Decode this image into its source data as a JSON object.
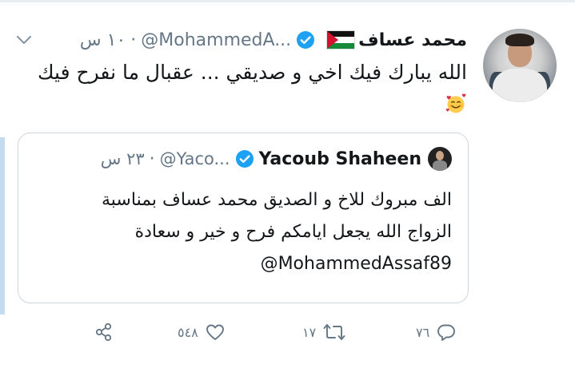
{
  "tweet": {
    "author_name": "محمد عساف",
    "handle": "@MohammedA...",
    "separator": "·",
    "time": "١٠ س",
    "text": "الله يبارك فيك اخي و صديقي ... عقبال ما نفرح فيك",
    "emoji": "smiling-face-with-hearts"
  },
  "quoted": {
    "author_name": "Yacoub Shaheen",
    "handle": "@Yaco...",
    "separator": "·",
    "time": "٢٣ س",
    "text_line1": "الف مبروك للاخ و الصديق محمد عساف بمناسبة",
    "text_line2": "الزواج الله يجعل ايامكم فرح و خير و سعادة",
    "mention": "@MohammedAssaf89"
  },
  "actions": {
    "reply_count": "٧٦",
    "retweet_count": "١٧",
    "like_count": "٥٤٨"
  },
  "colors": {
    "verified_blue": "#1da1f2",
    "muted_text": "#657786",
    "text": "#14171a",
    "border": "#ccd6dd"
  }
}
